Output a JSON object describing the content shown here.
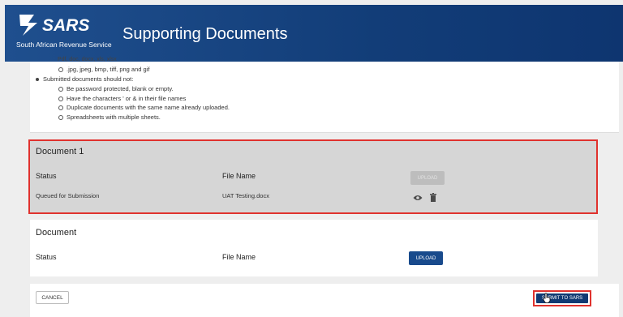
{
  "header": {
    "logo_text": "SARS",
    "logo_subtitle": "South African Revenue Service",
    "title": "Supporting Documents"
  },
  "instructions": {
    "cut_line": "Pdf, doc, docx, xls, xlsx",
    "allowed_formats_tail": [
      ".jpg, jpeg, bmp, tiff, png and gif"
    ],
    "rule_heading": "Submitted documents should not:",
    "rules": [
      "Be password protected, blank or empty.",
      "Have the characters ' or & in their file names",
      "Duplicate documents with the same name already uploaded.",
      "Spreadsheets with multiple sheets."
    ]
  },
  "document1": {
    "title": "Document 1",
    "status_label": "Status",
    "file_name_label": "File Name",
    "status_value": "Queued for Submission",
    "file_name_value": "UAT Testing.docx",
    "upload_label": "UPLOAD"
  },
  "document2": {
    "title": "Document",
    "status_label": "Status",
    "file_name_label": "File Name",
    "upload_label": "UPLOAD"
  },
  "footer": {
    "cancel_label": "CANCEL",
    "submit_label": "SUBMIT TO SARS"
  },
  "colors": {
    "header_blue": "#123d78",
    "button_blue": "#184a8c",
    "highlight_red": "#e0322e",
    "disabled_grey": "#bdbdbd"
  },
  "icons": [
    "sars-logo-icon",
    "eye-icon",
    "trash-icon",
    "cursor-hand-icon"
  ]
}
